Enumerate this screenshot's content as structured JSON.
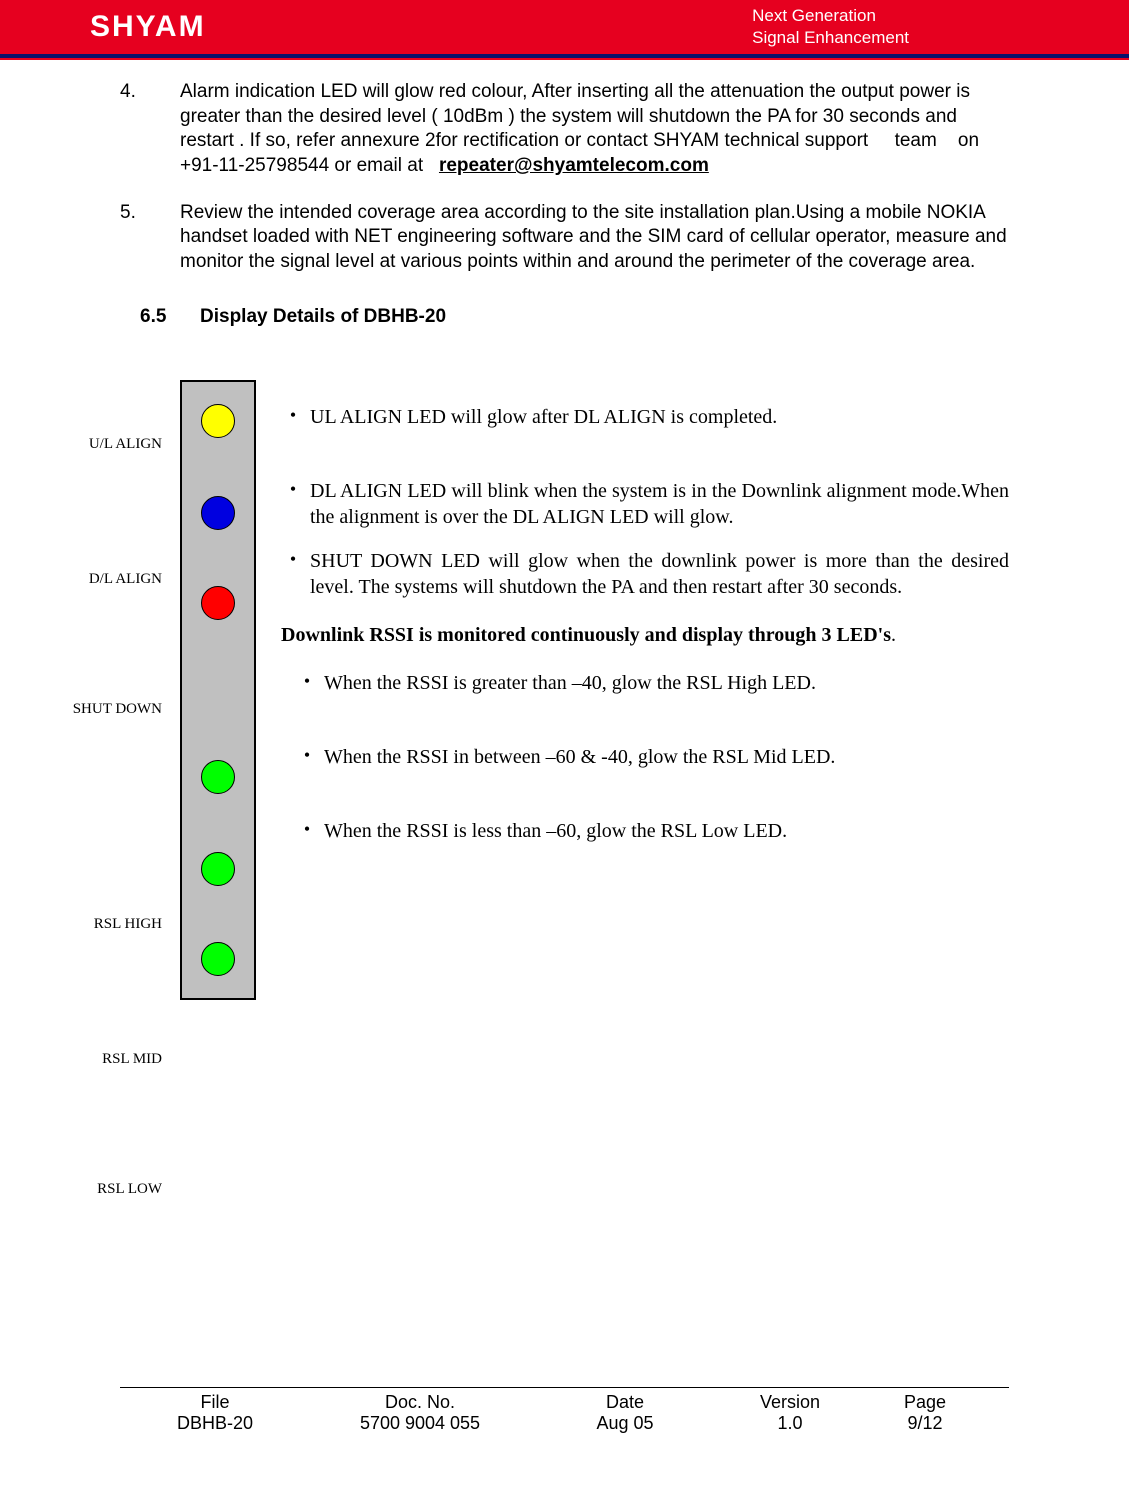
{
  "header": {
    "logo_text": "SHYAM",
    "tagline_line1": "Next Generation",
    "tagline_line2": "Signal Enhancement"
  },
  "items": {
    "n4": "4.",
    "p4_a": "Alarm indication LED will glow red colour, After inserting all the attenuation the output power is greater than the desired level ( 10dBm ) the system will shutdown the PA for 30 seconds and restart . If so, refer annexure 2for rectification or contact SHYAM technical support     team    on      +91-11-25798544 or email at   ",
    "p4_email": "repeater@shyamtelecom.com",
    "n5": "5.",
    "p5": "Review the intended coverage area according to the site installation plan.Using a mobile NOKIA handset loaded with NET engineering software and the SIM card of cellular operator, measure and monitor the signal level at various points within and around the perimeter of the coverage area."
  },
  "section": {
    "num": "6.5",
    "title": "Display Details of DBHB-20"
  },
  "led_labels": {
    "ul": "U/L ALIGN",
    "dl": "D/L ALIGN",
    "shut": "SHUT DOWN",
    "high": "RSL HIGH",
    "mid": "RSL MID",
    "low": "RSL LOW"
  },
  "led_desc": {
    "ul": "UL ALIGN LED will glow after DL ALIGN is completed.",
    "dl": "DL ALIGN LED will blink when the system is in the Downlink alignment mode.When the alignment is over the DL ALIGN LED will glow.",
    "shut": "SHUT DOWN LED will glow when the downlink power is more than the desired level. The systems will shutdown the PA and then restart after 30 seconds.",
    "rssi_head_a": "Downlink RSSI is monitored continuously and display through 3 LED's",
    "rssi_head_b": ".",
    "high": "When the RSSI is greater than –40, glow the RSL High LED.",
    "mid": "When the RSSI in between –60 & -40, glow the RSL Mid LED.",
    "low": "When the RSSI is less than –60, glow the RSL Low LED."
  },
  "footer": {
    "h_file": "File",
    "v_file": "DBHB-20",
    "h_doc": "Doc. No.",
    "v_doc": "5700 9004 055",
    "h_date": "Date",
    "v_date": "Aug 05",
    "h_ver": "Version",
    "v_ver": "1.0",
    "h_page": "Page",
    "v_page": "9/12"
  },
  "chart_data": {
    "type": "table",
    "title": "DBHB-20 Display LED Indicators",
    "rows": [
      {
        "label": "U/L ALIGN",
        "color": "yellow",
        "meaning": "Glows after DL ALIGN is completed"
      },
      {
        "label": "D/L ALIGN",
        "color": "blue",
        "meaning": "Blinks in Downlink alignment mode; glows when alignment is over"
      },
      {
        "label": "SHUT DOWN",
        "color": "red",
        "meaning": "Glows when downlink power exceeds desired level; PA shuts down then restarts after 30 s"
      },
      {
        "label": "RSL HIGH",
        "color": "green",
        "meaning": "Glows when RSSI > -40"
      },
      {
        "label": "RSL MID",
        "color": "green",
        "meaning": "Glows when -60 ≤ RSSI ≤ -40"
      },
      {
        "label": "RSL LOW",
        "color": "green",
        "meaning": "Glows when RSSI < -60"
      }
    ]
  }
}
